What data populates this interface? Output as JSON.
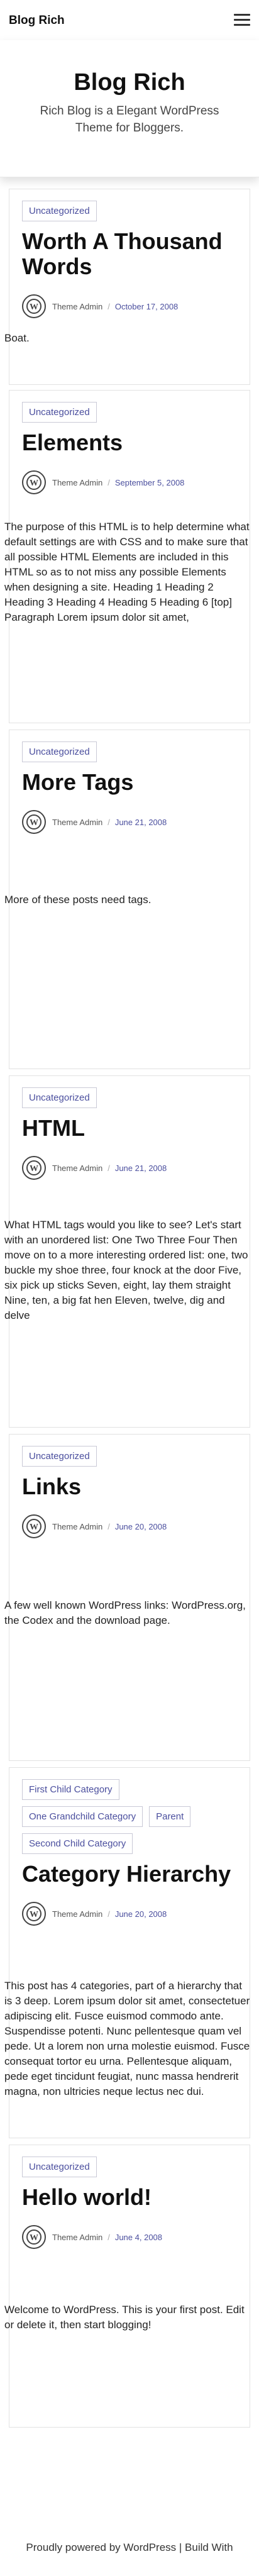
{
  "header": {
    "site_title": "Blog Rich",
    "menu_icon": "hamburger-icon"
  },
  "hero": {
    "title": "Blog Rich",
    "description": "Rich Blog is a Elegant WordPress Theme for Bloggers."
  },
  "posts": [
    {
      "categories": [
        "Uncategorized"
      ],
      "title": "Worth A Thousand Words",
      "author": "Theme Admin",
      "date": "October 17, 2008",
      "excerpt": "Boat."
    },
    {
      "categories": [
        "Uncategorized"
      ],
      "title": "Elements",
      "author": "Theme Admin",
      "date": "September 5, 2008",
      "excerpt": "The purpose of this HTML is to help determine what default settings are with CSS and to make sure that all possible HTML Elements are included in this HTML so as to not miss any possible Elements when designing a site. Heading 1 Heading 2 Heading 3 Heading 4 Heading 5 Heading 6 [top] Paragraph Lorem ipsum dolor sit amet,"
    },
    {
      "categories": [
        "Uncategorized"
      ],
      "title": "More Tags",
      "author": "Theme Admin",
      "date": "June 21, 2008",
      "excerpt": "More of these posts need tags."
    },
    {
      "categories": [
        "Uncategorized"
      ],
      "title": "HTML",
      "author": "Theme Admin",
      "date": "June 21, 2008",
      "excerpt": "What HTML tags would you like to see? Let's start with an unordered list: One Two Three Four Then move on to a more interesting ordered list: one, two buckle my shoe three, four knock at the door Five, six pick up sticks Seven, eight, lay them straight Nine, ten, a big fat hen Eleven, twelve, dig and delve"
    },
    {
      "categories": [
        "Uncategorized"
      ],
      "title": "Links",
      "author": "Theme Admin",
      "date": "June 20, 2008",
      "excerpt": "A few well known WordPress links: WordPress.org, the Codex and the download page."
    },
    {
      "categories": [
        "First Child Category",
        "One Grandchild Category",
        "Parent",
        "Second Child Category"
      ],
      "title": "Category Hierarchy",
      "author": "Theme Admin",
      "date": "June 20, 2008",
      "excerpt": "This post has 4 categories, part of a hierarchy that is 3 deep. Lorem ipsum dolor sit amet, consectetuer adipiscing elit. Fusce euismod commodo ante. Suspendisse potenti. Nunc pellentesque quam vel pede. Ut a lorem non urna molestie euismod. Fusce consequat tortor eu urna. Pellentesque aliquam, pede eget tincidunt feugiat, nunc massa hendrerit magna, non ultricies neque lectus nec dui."
    },
    {
      "categories": [
        "Uncategorized"
      ],
      "title": "Hello world!",
      "author": "Theme Admin",
      "date": "June 4, 2008",
      "excerpt": "Welcome to WordPress. This is your first post. Edit or delete it, then start blogging!"
    }
  ],
  "footer": {
    "text": "Proudly powered by WordPress | Build With"
  }
}
